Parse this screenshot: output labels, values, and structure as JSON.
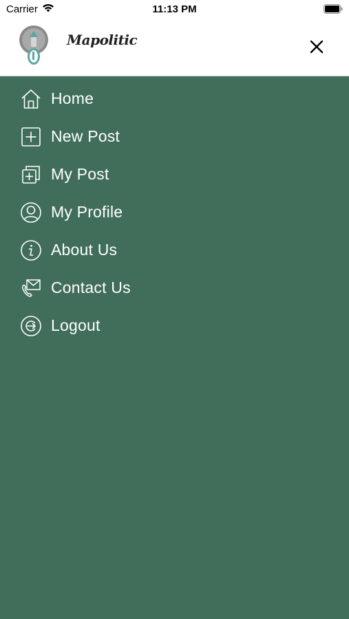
{
  "status_bar": {
    "carrier": "Carrier",
    "time": "11:13 PM"
  },
  "header": {
    "logo_text": "Mapolitic"
  },
  "menu": {
    "items": [
      {
        "label": "Home",
        "icon": "home-icon"
      },
      {
        "label": "New Post",
        "icon": "plus-square-icon"
      },
      {
        "label": "My Post",
        "icon": "stacked-posts-icon"
      },
      {
        "label": "My Profile",
        "icon": "user-circle-icon"
      },
      {
        "label": "About Us",
        "icon": "info-circle-icon"
      },
      {
        "label": "Contact Us",
        "icon": "mail-phone-icon"
      },
      {
        "label": "Logout",
        "icon": "logout-circle-icon"
      }
    ]
  },
  "colors": {
    "drawer_bg": "#406e5a",
    "header_bg": "#ffffff",
    "menu_text": "#ffffff"
  }
}
